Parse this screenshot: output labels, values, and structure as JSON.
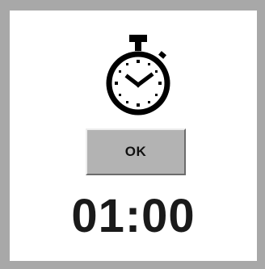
{
  "dialog": {
    "icon": "stopwatch-icon",
    "ok_label": "OK",
    "time_remaining": "01:00"
  },
  "colors": {
    "frame": "#a8a8a8",
    "panel": "#ffffff",
    "button_face": "#b3b3b3",
    "text": "#1a1a1a"
  }
}
